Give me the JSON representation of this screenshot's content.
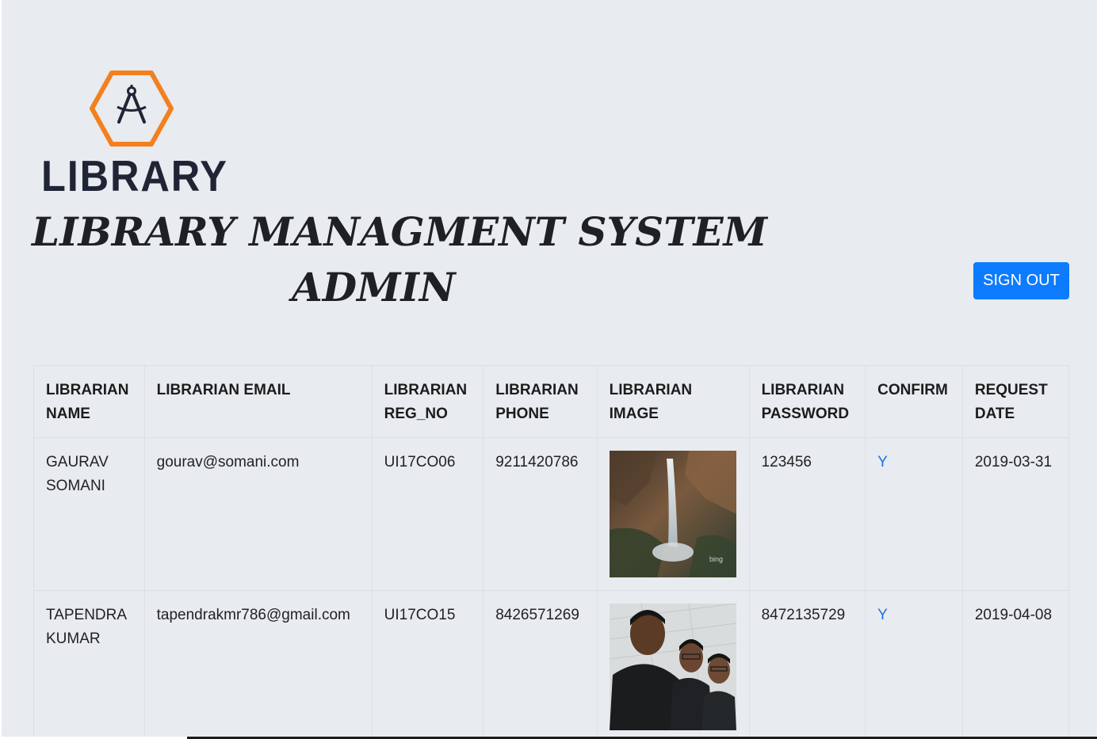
{
  "brand": {
    "logo_text": "LIBRARY",
    "accent_color": "#f2801f",
    "logo_icon": "compass-icon"
  },
  "header": {
    "title_line1": "LIBRARY MANAGMENT SYSTEM",
    "title_line2": "ADMIN",
    "signout_label": "SIGN OUT"
  },
  "table": {
    "columns": [
      "LIBRARIAN NAME",
      "LIBRARIAN EMAIL",
      "LIBRARIAN REG_NO",
      "LIBRARIAN PHONE",
      "LIBRARIAN IMAGE",
      "LIBRARIAN PASSWORD",
      "CONFIRM",
      "REQUEST DATE"
    ],
    "rows": [
      {
        "name": "GAURAV SOMANI",
        "email": "gourav@somani.com",
        "reg_no": "UI17CO06",
        "phone": "9211420786",
        "image_desc": "waterfall-photo",
        "image_watermark": "bing",
        "password": "123456",
        "confirm": "Y",
        "date": "2019-03-31"
      },
      {
        "name": "TAPENDRA KUMAR",
        "email": "tapendrakmr786@gmail.com",
        "reg_no": "UI17CO15",
        "phone": "8426571269",
        "image_desc": "group-selfie-photo",
        "password": "8472135729",
        "confirm": "Y",
        "date": "2019-04-08"
      }
    ]
  }
}
